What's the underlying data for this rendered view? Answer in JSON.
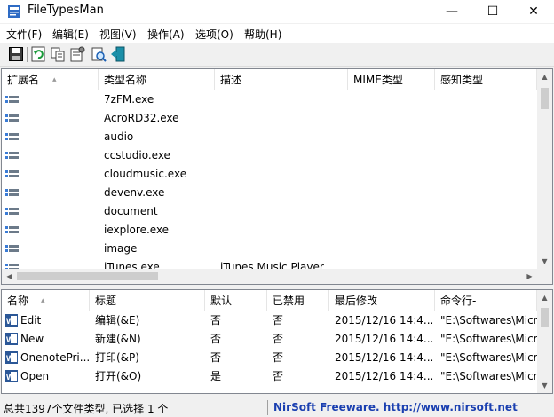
{
  "window": {
    "title": "FileTypesMan",
    "minimize_glyph": "—",
    "maximize_glyph": "☐",
    "close_glyph": "✕"
  },
  "menu": [
    "文件(F)",
    "编辑(E)",
    "视图(V)",
    "操作(A)",
    "选项(O)",
    "帮助(H)"
  ],
  "toolbar_icons": [
    "save-icon",
    "refresh-icon",
    "copy-icon",
    "properties-icon",
    "find-icon",
    "exit-icon"
  ],
  "file_types": {
    "columns": [
      "扩展名",
      "类型名称",
      "描述",
      "MIME类型",
      "感知类型"
    ],
    "sort_column": "扩展名",
    "sort_glyph": "▴",
    "rows": [
      {
        "ext": "",
        "type_name": "7zFM.exe",
        "desc": ""
      },
      {
        "ext": "",
        "type_name": "AcroRD32.exe",
        "desc": ""
      },
      {
        "ext": "",
        "type_name": "audio",
        "desc": ""
      },
      {
        "ext": "",
        "type_name": "ccstudio.exe",
        "desc": ""
      },
      {
        "ext": "",
        "type_name": "cloudmusic.exe",
        "desc": ""
      },
      {
        "ext": "",
        "type_name": "devenv.exe",
        "desc": ""
      },
      {
        "ext": "",
        "type_name": "document",
        "desc": ""
      },
      {
        "ext": "",
        "type_name": "iexplore.exe",
        "desc": ""
      },
      {
        "ext": "",
        "type_name": "image",
        "desc": ""
      },
      {
        "ext": "",
        "type_name": "iTunes.exe",
        "desc": "iTunes Music Player"
      }
    ]
  },
  "actions": {
    "columns": [
      "名称",
      "标题",
      "默认",
      "已禁用",
      "最后修改",
      "命令行-"
    ],
    "sort_column": "名称",
    "sort_glyph": "▴",
    "rows": [
      {
        "name": "Edit",
        "caption": "编辑(&E)",
        "default": "否",
        "disabled": "否",
        "modified": "2015/12/16 14:4...",
        "command": "\"E:\\Softwares\\Micr"
      },
      {
        "name": "New",
        "caption": "新建(&N)",
        "default": "否",
        "disabled": "否",
        "modified": "2015/12/16 14:4...",
        "command": "\"E:\\Softwares\\Micr"
      },
      {
        "name": "OnenotePri...",
        "caption": "打印(&P)",
        "default": "否",
        "disabled": "否",
        "modified": "2015/12/16 14:4...",
        "command": "\"E:\\Softwares\\Micr"
      },
      {
        "name": "Open",
        "caption": "打开(&O)",
        "default": "是",
        "disabled": "否",
        "modified": "2015/12/16 14:4...",
        "command": "\"E:\\Softwares\\Micr"
      }
    ]
  },
  "status": {
    "summary": "总共1397个文件类型, 已选择 1 个",
    "credit": "NirSoft Freeware.  http://www.nirsoft.net"
  },
  "colors": {
    "credit": "#1a3fb0",
    "word_icon": "#2b5797"
  }
}
